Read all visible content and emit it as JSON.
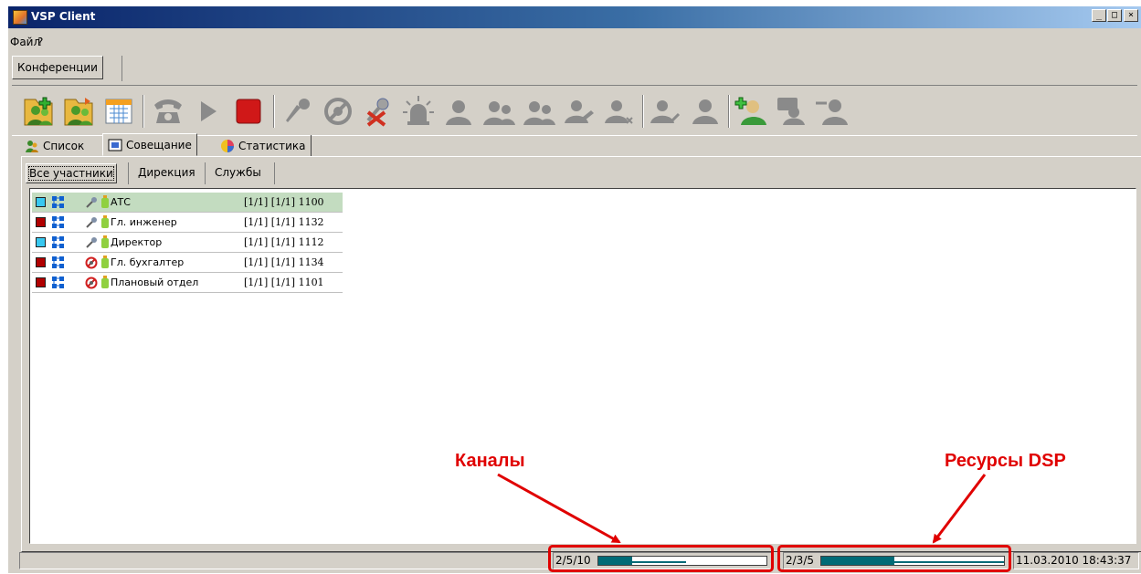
{
  "window": {
    "title": "VSP Client"
  },
  "menu": {
    "items": [
      "Файл",
      "?"
    ]
  },
  "conf_tab": {
    "label": "Конференции"
  },
  "toolbar": {
    "icons": [
      "add-conference-icon",
      "add-conference-alt-icon",
      "calendar-icon",
      "phone-icon",
      "play-icon",
      "stop-icon",
      "microphone-icon",
      "mute-icon",
      "remove-microphone-icon",
      "alarm-icon",
      "user-icon",
      "users-icon",
      "users-alt-icon",
      "user-edit-icon",
      "user-remove-icon",
      "user-check-icon",
      "user-single-icon",
      "add-user-icon",
      "user-talk-icon",
      "user-minus-icon"
    ]
  },
  "main_tabs": [
    {
      "label": "Список",
      "icon": "list-users-icon"
    },
    {
      "label": "Совещание",
      "icon": "meeting-icon"
    },
    {
      "label": "Статистика",
      "icon": "pie-chart-icon"
    }
  ],
  "sub_tabs": [
    {
      "label": "Все участники",
      "active": true
    },
    {
      "label": "Дирекция",
      "active": false
    },
    {
      "label": "Службы",
      "active": false
    }
  ],
  "participants": [
    {
      "name": "АТС",
      "channels": "[1/1] [1/1] 1100",
      "status_color": "#38c8f0",
      "icon": "microphone-icon",
      "selected": true
    },
    {
      "name": "Гл. инженер",
      "channels": "[1/1] [1/1] 1132",
      "status_color": "#b00000",
      "icon": "microphone-icon",
      "selected": false
    },
    {
      "name": "Директор",
      "channels": "[1/1] [1/1] 1112",
      "status_color": "#38c8f0",
      "icon": "microphone-icon",
      "selected": false
    },
    {
      "name": "Гл. бухгалтер",
      "channels": "[1/1] [1/1] 1134",
      "status_color": "#b00000",
      "icon": "mute-icon",
      "selected": false
    },
    {
      "name": "Плановый отдел",
      "channels": "[1/1] [1/1] 1101",
      "status_color": "#b00000",
      "icon": "mute-icon",
      "selected": false
    }
  ],
  "status": {
    "channels_text": "2/5/10",
    "channels_fraction": 0.2,
    "dsp_text": "2/3/5",
    "dsp_fraction": 0.4,
    "datetime": "11.03.2010 18:43:37"
  },
  "annotations": {
    "channels_label": "Каналы",
    "dsp_label": "Ресурсы DSP",
    "color": "#e00000"
  }
}
